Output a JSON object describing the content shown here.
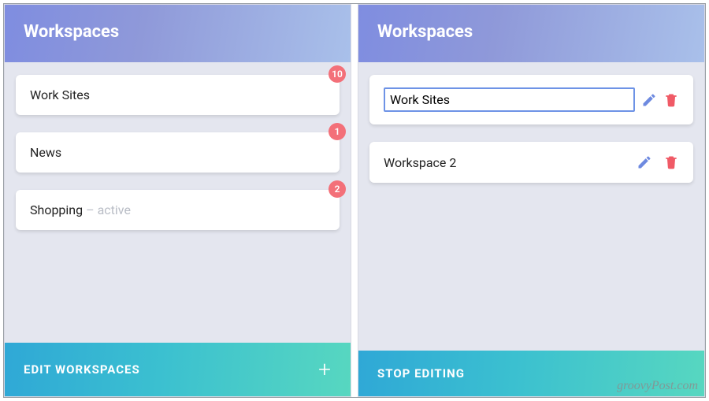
{
  "left": {
    "header": "Workspaces",
    "items": [
      {
        "name": "Work Sites",
        "badge": "10",
        "active": false
      },
      {
        "name": "News",
        "badge": "1",
        "active": false
      },
      {
        "name": "Shopping",
        "badge": "2",
        "active": true,
        "active_label": "– active"
      }
    ],
    "footer_label": "EDIT WORKSPACES",
    "plus": "+"
  },
  "right": {
    "header": "Workspaces",
    "items": [
      {
        "name": "Work Sites",
        "editing": true
      },
      {
        "name": "Workspace 2",
        "editing": false
      }
    ],
    "footer_label": "STOP EDITING"
  },
  "colors": {
    "badge": "#f37079",
    "pencil": "#6e8ae0",
    "trash": "#f05a66",
    "input_border": "#6e93e6"
  },
  "watermark": "groovyPost.com"
}
